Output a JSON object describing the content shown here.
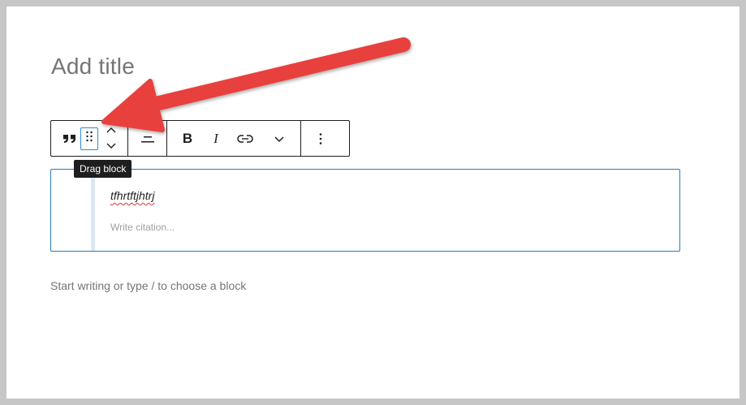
{
  "editor": {
    "title_placeholder": "Add title",
    "paragraph_placeholder": "Start writing or type / to choose a block"
  },
  "toolbar": {
    "items": [
      {
        "name": "quote-block-type",
        "icon": "quote-icon"
      },
      {
        "name": "drag-block",
        "icon": "drag-handle-icon"
      },
      {
        "name": "move-up",
        "icon": "chevron-up-icon"
      },
      {
        "name": "move-down",
        "icon": "chevron-down-icon"
      },
      {
        "name": "align",
        "icon": "align-icon"
      },
      {
        "name": "bold",
        "icon": "bold-icon"
      },
      {
        "name": "italic",
        "icon": "italic-icon"
      },
      {
        "name": "link",
        "icon": "link-icon"
      },
      {
        "name": "more-rich-text",
        "icon": "chevron-down-icon"
      },
      {
        "name": "options",
        "icon": "more-vertical-icon"
      }
    ],
    "bold_label": "B",
    "italic_label": "I"
  },
  "tooltip": {
    "text": "Drag block"
  },
  "quote": {
    "text": "tfhrtftjhtrj",
    "citation_placeholder": "Write citation..."
  },
  "annotation": {
    "arrow_color": "#e8403e"
  },
  "colors": {
    "accent": "#2a7bb6",
    "quote_bar": "#dbe7f4"
  }
}
